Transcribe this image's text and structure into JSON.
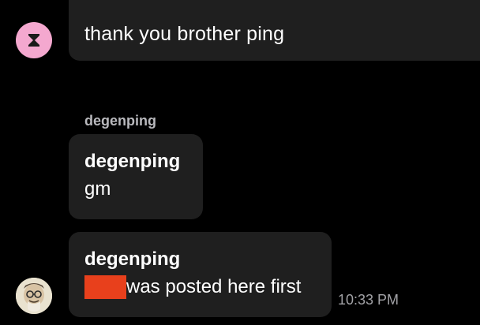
{
  "messages": [
    {
      "text": "thank you brother ping"
    }
  ],
  "group": {
    "sender": "degenping",
    "bubbles": [
      {
        "name": "degenping",
        "text": "gm"
      },
      {
        "name": "degenping",
        "text": "was posted here first",
        "time": "10:33 PM"
      }
    ]
  },
  "colors": {
    "background": "#000000",
    "bubble": "#1f1f1f",
    "pink_avatar": "#f4a8cf",
    "redaction": "#e8401c",
    "sender_label": "#b9b9bd",
    "timestamp": "#a2a2a6"
  },
  "icons": {
    "first_avatar": "hourglass-icon",
    "second_avatar": "user-photo"
  }
}
